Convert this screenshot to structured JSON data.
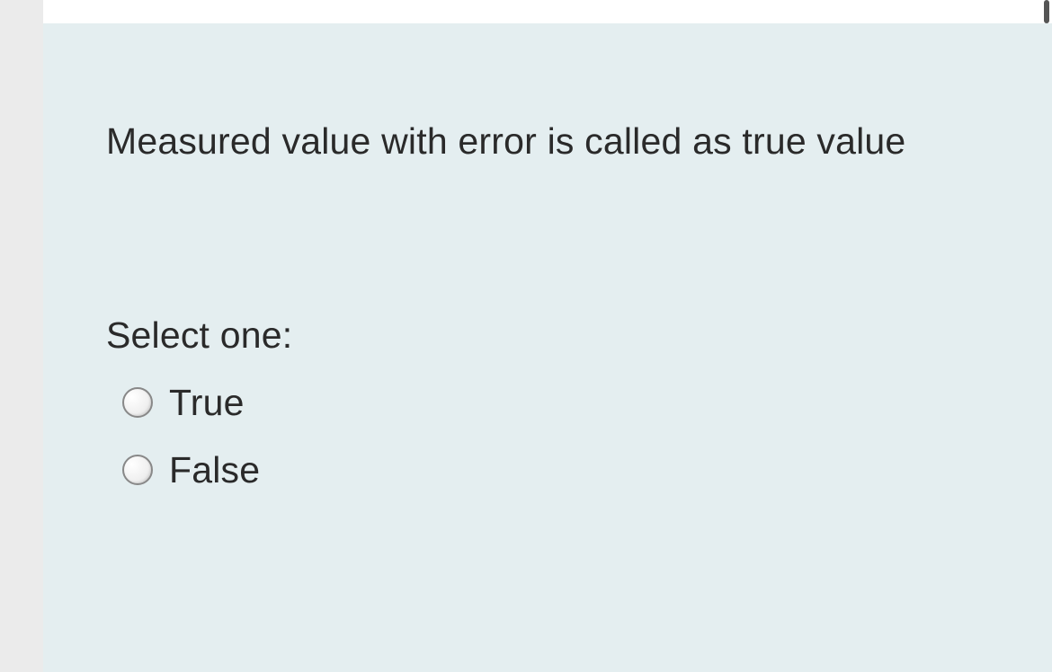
{
  "question": {
    "text": "Measured value with  error is called as true value",
    "prompt": "Select one:",
    "options": [
      {
        "label": "True"
      },
      {
        "label": "False"
      }
    ]
  }
}
